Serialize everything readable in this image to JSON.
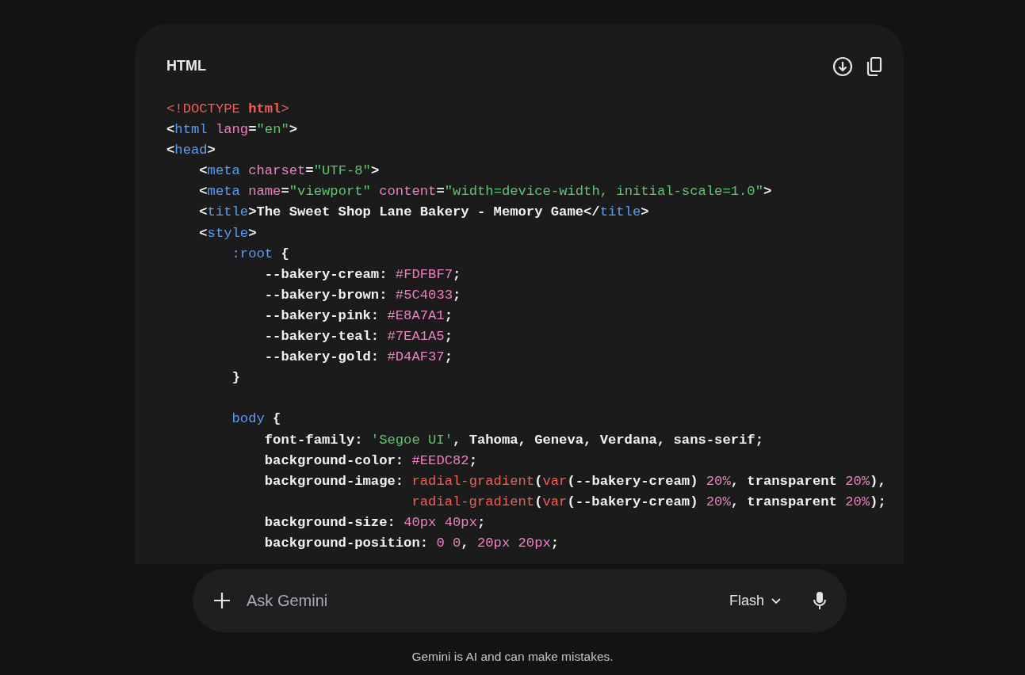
{
  "code_block": {
    "language": "HTML",
    "actions": [
      {
        "kind": "download"
      },
      {
        "kind": "copy"
      }
    ],
    "lines": [
      {
        "tokens": [
          {
            "kind": "keyword",
            "t": "<!DOCTYPE "
          },
          {
            "kind": "keyword-bold",
            "t": "html"
          },
          {
            "kind": "keyword",
            "t": ">"
          }
        ]
      },
      {
        "tokens": [
          {
            "kind": "plain",
            "t": "<"
          },
          {
            "kind": "tag",
            "t": "html"
          },
          {
            "kind": "attr",
            "t": " lang"
          },
          {
            "kind": "plain",
            "t": "="
          },
          {
            "kind": "string",
            "t": "\"en\""
          },
          {
            "kind": "plain",
            "t": ">"
          }
        ]
      },
      {
        "tokens": [
          {
            "kind": "plain",
            "t": "<"
          },
          {
            "kind": "tag",
            "t": "head"
          },
          {
            "kind": "plain",
            "t": ">"
          }
        ]
      },
      {
        "tokens": [
          {
            "kind": "plain",
            "t": "    <"
          },
          {
            "kind": "tag",
            "t": "meta"
          },
          {
            "kind": "attr",
            "t": " charset"
          },
          {
            "kind": "plain",
            "t": "="
          },
          {
            "kind": "string",
            "t": "\"UTF-8\""
          },
          {
            "kind": "plain",
            "t": ">"
          }
        ]
      },
      {
        "tokens": [
          {
            "kind": "plain",
            "t": "    <"
          },
          {
            "kind": "tag",
            "t": "meta"
          },
          {
            "kind": "attr",
            "t": " name"
          },
          {
            "kind": "plain",
            "t": "="
          },
          {
            "kind": "string",
            "t": "\"viewport\""
          },
          {
            "kind": "attr",
            "t": " content"
          },
          {
            "kind": "plain",
            "t": "="
          },
          {
            "kind": "string",
            "t": "\"width=device-width, initial-scale=1.0\""
          },
          {
            "kind": "plain",
            "t": ">"
          }
        ]
      },
      {
        "tokens": [
          {
            "kind": "plain",
            "t": "    <"
          },
          {
            "kind": "tag",
            "t": "title"
          },
          {
            "kind": "plain",
            "t": ">The Sweet Shop Lane Bakery - Memory Game</"
          },
          {
            "kind": "tag",
            "t": "title"
          },
          {
            "kind": "plain",
            "t": ">"
          }
        ]
      },
      {
        "tokens": [
          {
            "kind": "plain",
            "t": "    <"
          },
          {
            "kind": "tag",
            "t": "style"
          },
          {
            "kind": "plain",
            "t": ">"
          }
        ]
      },
      {
        "tokens": [
          {
            "kind": "tag",
            "t": "        :root"
          },
          {
            "kind": "plain",
            "t": " {"
          }
        ]
      },
      {
        "tokens": [
          {
            "kind": "plain",
            "t": "            --bakery-cream: "
          },
          {
            "kind": "number",
            "t": "#FDFBF7"
          },
          {
            "kind": "plain",
            "t": ";"
          }
        ]
      },
      {
        "tokens": [
          {
            "kind": "plain",
            "t": "            --bakery-brown: "
          },
          {
            "kind": "number",
            "t": "#5C4033"
          },
          {
            "kind": "plain",
            "t": ";"
          }
        ]
      },
      {
        "tokens": [
          {
            "kind": "plain",
            "t": "            --bakery-pink: "
          },
          {
            "kind": "number",
            "t": "#E8A7A1"
          },
          {
            "kind": "plain",
            "t": ";"
          }
        ]
      },
      {
        "tokens": [
          {
            "kind": "plain",
            "t": "            --bakery-teal: "
          },
          {
            "kind": "number",
            "t": "#7EA1A5"
          },
          {
            "kind": "plain",
            "t": ";"
          }
        ]
      },
      {
        "tokens": [
          {
            "kind": "plain",
            "t": "            --bakery-gold: "
          },
          {
            "kind": "number",
            "t": "#D4AF37"
          },
          {
            "kind": "plain",
            "t": ";"
          }
        ]
      },
      {
        "tokens": [
          {
            "kind": "plain",
            "t": "        }"
          }
        ]
      },
      {
        "blank_before": true,
        "tokens": [
          {
            "kind": "tag",
            "t": "        body"
          },
          {
            "kind": "plain",
            "t": " {"
          }
        ]
      },
      {
        "tokens": [
          {
            "kind": "plain",
            "t": "            font-family: "
          },
          {
            "kind": "string",
            "t": "'Segoe UI'"
          },
          {
            "kind": "plain",
            "t": ", Tahoma, Geneva, Verdana, sans-serif;"
          }
        ]
      },
      {
        "tokens": [
          {
            "kind": "plain",
            "t": "            background-color: "
          },
          {
            "kind": "number",
            "t": "#EEDC82"
          },
          {
            "kind": "plain",
            "t": ";"
          }
        ]
      },
      {
        "tokens": [
          {
            "kind": "plain",
            "t": "            background-image: "
          },
          {
            "kind": "keyword",
            "t": "radial-gradient"
          },
          {
            "kind": "plain",
            "t": "("
          },
          {
            "kind": "keyword",
            "t": "var"
          },
          {
            "kind": "plain",
            "t": "(--bakery-cream) "
          },
          {
            "kind": "number",
            "t": "20%"
          },
          {
            "kind": "plain",
            "t": ", transparent "
          },
          {
            "kind": "number",
            "t": "20%"
          },
          {
            "kind": "plain",
            "t": "),"
          }
        ]
      },
      {
        "tokens": [
          {
            "kind": "keyword",
            "t": "                              radial-gradient"
          },
          {
            "kind": "plain",
            "t": "("
          },
          {
            "kind": "keyword",
            "t": "var"
          },
          {
            "kind": "plain",
            "t": "(--bakery-cream) "
          },
          {
            "kind": "number",
            "t": "20%"
          },
          {
            "kind": "plain",
            "t": ", transparent "
          },
          {
            "kind": "number",
            "t": "20%"
          },
          {
            "kind": "plain",
            "t": ");"
          }
        ]
      },
      {
        "tokens": [
          {
            "kind": "plain",
            "t": "            background-size: "
          },
          {
            "kind": "number",
            "t": "40px 40px"
          },
          {
            "kind": "plain",
            "t": ";"
          }
        ]
      },
      {
        "tokens": [
          {
            "kind": "plain",
            "t": "            background-position: "
          },
          {
            "kind": "number",
            "t": "0 0"
          },
          {
            "kind": "plain",
            "t": ", "
          },
          {
            "kind": "number",
            "t": "20px 20px"
          },
          {
            "kind": "plain",
            "t": ";"
          }
        ]
      }
    ]
  },
  "prompt": {
    "placeholder": "Ask Gemini",
    "model": "Flash"
  },
  "disclaimer": "Gemini is AI and can make mistakes."
}
